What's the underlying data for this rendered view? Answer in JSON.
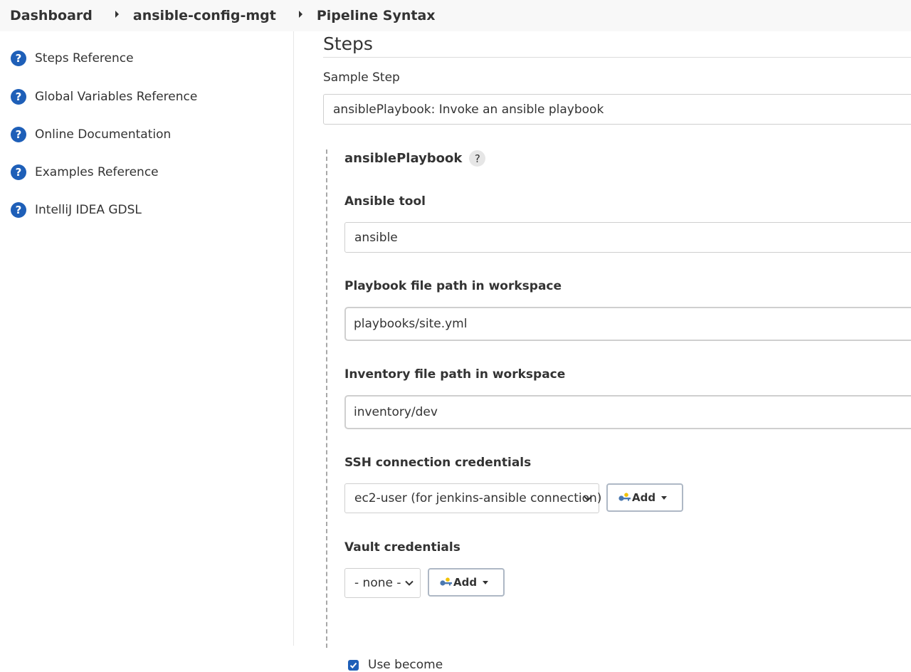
{
  "breadcrumb": {
    "items": [
      "Dashboard",
      "ansible-config-mgt",
      "Pipeline Syntax"
    ]
  },
  "sidebar": {
    "items": [
      {
        "label": "Steps Reference",
        "icon": "help-icon"
      },
      {
        "label": "Global Variables Reference",
        "icon": "help-icon"
      },
      {
        "label": "Online Documentation",
        "icon": "help-icon"
      },
      {
        "label": "Examples Reference",
        "icon": "help-icon"
      },
      {
        "label": "IntelliJ IDEA GDSL",
        "icon": "help-icon"
      }
    ],
    "help_glyph": "?"
  },
  "main": {
    "title": "Steps",
    "sample_step_label": "Sample Step",
    "sample_step_value": "ansiblePlaybook: Invoke an ansible playbook",
    "step": {
      "name": "ansiblePlaybook",
      "help_glyph": "?",
      "fields": {
        "ansible_tool": {
          "label": "Ansible tool",
          "value": "ansible"
        },
        "playbook_path": {
          "label": "Playbook file path in workspace",
          "value": "playbooks/site.yml"
        },
        "inventory_path": {
          "label": "Inventory file path in workspace",
          "value": "inventory/dev"
        },
        "ssh_credentials": {
          "label": "SSH connection credentials",
          "value": "ec2-user (for jenkins-ansible connection)",
          "add_label": "Add"
        },
        "vault_credentials": {
          "label": "Vault credentials",
          "value": "- none -",
          "add_label": "Add"
        },
        "use_become": {
          "label": "Use become",
          "checked": true
        }
      }
    }
  },
  "colors": {
    "accent": "#1e5fb8",
    "breadcrumb_bg": "#f8f8f8",
    "text": "#333333"
  }
}
